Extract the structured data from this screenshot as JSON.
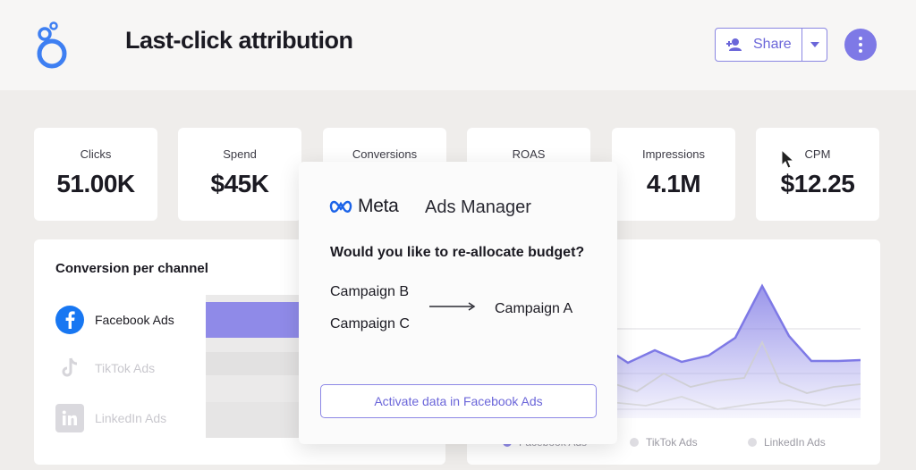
{
  "header": {
    "title": "Last-click attribution",
    "share_label": "Share",
    "accent": "#7e79e6"
  },
  "kpis": [
    {
      "label": "Clicks",
      "value": "51.00K"
    },
    {
      "label": "Spend",
      "value": "$45K"
    },
    {
      "label": "Conversions",
      "value": ""
    },
    {
      "label": "ROAS",
      "value": ""
    },
    {
      "label": "Impressions",
      "value": "4.1M"
    },
    {
      "label": "CPM",
      "value": "$12.25"
    }
  ],
  "conversion_panel": {
    "title": "Conversion per channel",
    "channels": [
      {
        "label": "Facebook Ads",
        "icon": "facebook-icon"
      },
      {
        "label": "TikTok Ads",
        "icon": "tiktok-icon"
      },
      {
        "label": "LinkedIn Ads",
        "icon": "linkedin-icon"
      }
    ]
  },
  "trend_panel": {
    "legend": [
      "Facebook Ads",
      "TikTok Ads",
      "LinkedIn Ads"
    ],
    "colors": [
      "#8f8ae8",
      "#cfcfd4",
      "#d9d9dd"
    ]
  },
  "modal": {
    "brand": "Meta",
    "product": "Ads Manager",
    "question": "Would you like to re-allocate budget?",
    "from": [
      "Campaign B",
      "Campaign C"
    ],
    "to": "Campaign A",
    "activate_label": "Activate data in Facebook Ads"
  }
}
